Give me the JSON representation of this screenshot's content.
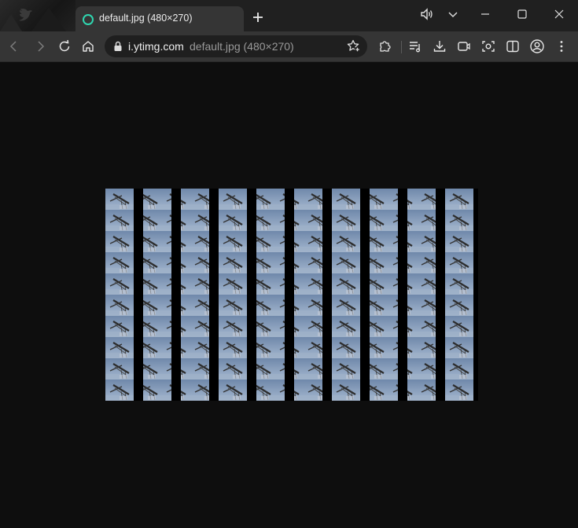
{
  "tab": {
    "title": "default.jpg (480×270)"
  },
  "address_bar": {
    "host": "i.ytimg.com",
    "path": "default.jpg (480×270)"
  },
  "icons": {
    "tab_loading": "loading-ring-icon",
    "new_tab": "plus-icon",
    "volume": "speaker-icon",
    "tab_search": "chevron-down-icon",
    "minimize": "minimize-icon",
    "maximize": "maximize-icon",
    "close": "close-icon",
    "back": "back-arrow-icon",
    "forward": "forward-arrow-icon",
    "reload": "reload-icon",
    "home": "home-icon",
    "site_info": "lock-icon",
    "favorites": "star-plus-icon",
    "extensions": "puzzle-icon",
    "playlist": "media-list-icon",
    "downloads": "download-icon",
    "record": "record-icon",
    "screenshot": "camera-capture-icon",
    "split_view": "split-view-icon",
    "profile": "profile-icon",
    "menu": "more-vertical-icon"
  },
  "colors": {
    "titlebar": "#202020",
    "toolbar": "#353535",
    "page_bg": "#0e0e0e",
    "loader": "#2fd6b0",
    "sky": "#8fa6c6"
  },
  "image": {
    "columns": 10,
    "rows": 10
  }
}
